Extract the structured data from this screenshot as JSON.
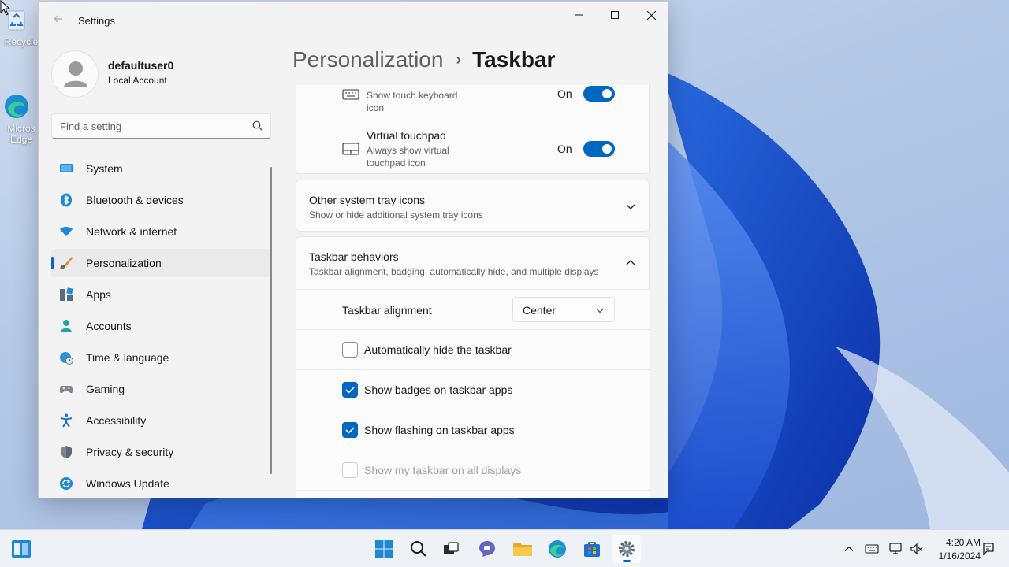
{
  "desktop": {
    "icons": [
      {
        "label": "Recycle"
      },
      {
        "label": "Micros Edge"
      }
    ]
  },
  "window": {
    "title": "Settings"
  },
  "profile": {
    "name": "defaultuser0",
    "account_type": "Local Account"
  },
  "search": {
    "placeholder": "Find a setting"
  },
  "sidebar": {
    "items": [
      {
        "label": "System",
        "icon": "system-icon"
      },
      {
        "label": "Bluetooth & devices",
        "icon": "bluetooth-icon"
      },
      {
        "label": "Network & internet",
        "icon": "wifi-icon"
      },
      {
        "label": "Personalization",
        "icon": "brush-icon",
        "selected": true
      },
      {
        "label": "Apps",
        "icon": "apps-icon"
      },
      {
        "label": "Accounts",
        "icon": "person-icon"
      },
      {
        "label": "Time & language",
        "icon": "globe-clock-icon"
      },
      {
        "label": "Gaming",
        "icon": "gamepad-icon"
      },
      {
        "label": "Accessibility",
        "icon": "accessibility-icon"
      },
      {
        "label": "Privacy & security",
        "icon": "shield-icon"
      },
      {
        "label": "Windows Update",
        "icon": "update-icon"
      }
    ]
  },
  "breadcrumb": {
    "parent": "Personalization",
    "separator": "›",
    "current": "Taskbar"
  },
  "content": {
    "touch_keyboard": {
      "desc": "Show touch keyboard icon",
      "state": "On",
      "on": true
    },
    "virtual_touchpad": {
      "title": "Virtual touchpad",
      "desc": "Always show virtual touchpad icon",
      "state": "On",
      "on": true
    },
    "other_tray": {
      "title": "Other system tray icons",
      "desc": "Show or hide additional system tray icons",
      "expanded": false
    },
    "behaviors": {
      "title": "Taskbar behaviors",
      "desc": "Taskbar alignment, badging, automatically hide, and multiple displays",
      "expanded": true,
      "alignment_label": "Taskbar alignment",
      "alignment_value": "Center",
      "checks": [
        {
          "label": "Automatically hide the taskbar",
          "checked": false,
          "disabled": false
        },
        {
          "label": "Show badges on taskbar apps",
          "checked": true,
          "disabled": false
        },
        {
          "label": "Show flashing on taskbar apps",
          "checked": true,
          "disabled": false
        },
        {
          "label": "Show my taskbar on all displays",
          "checked": false,
          "disabled": true
        }
      ]
    }
  },
  "taskbar": {
    "apps": [
      "start-icon",
      "search-icon",
      "task-view-icon",
      "chat-icon",
      "file-explorer-icon",
      "edge-icon",
      "store-icon",
      "settings-icon"
    ],
    "active_app": "settings-icon",
    "tray": [
      "chevron-up-icon",
      "keyboard-icon",
      "network-icon",
      "volume-muted-icon",
      "notification-icon"
    ]
  },
  "clock": {
    "time": "4:20 AM",
    "date": "1/16/2024"
  },
  "colors": {
    "accent": "#0067c0",
    "window_bg": "#f3f3f3",
    "card_bg": "#fbfbfb"
  }
}
